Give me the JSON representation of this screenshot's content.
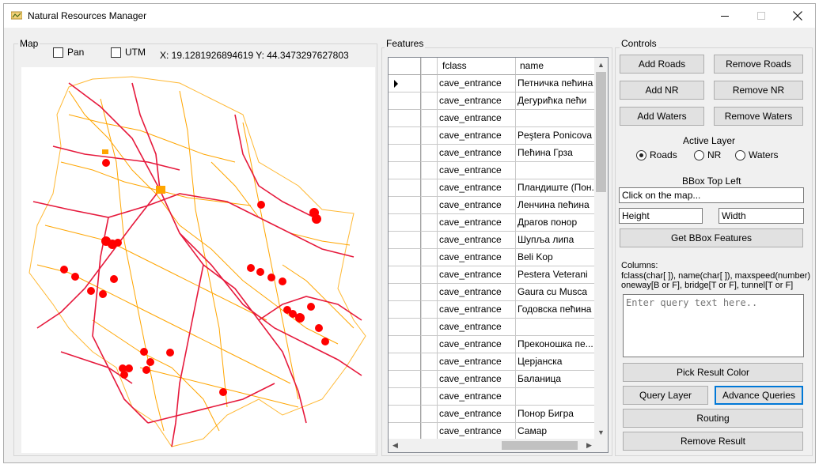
{
  "window": {
    "title": "Natural Resources Manager"
  },
  "map": {
    "group_label": "Map",
    "pan_label": "Pan",
    "utm_label": "UTM",
    "coords_text": "X: 19.1281926894619  Y: 44.3473297627803",
    "colors": {
      "roads": "#e6193c",
      "waters": "#ffa500",
      "points": "#ff0000"
    }
  },
  "features": {
    "group_label": "Features",
    "columns": [
      "",
      "",
      "fclass",
      "name"
    ],
    "rows": [
      {
        "fclass": "cave_entrance",
        "name": "Петничка пећина"
      },
      {
        "fclass": "cave_entrance",
        "name": "Дегурићка пећи"
      },
      {
        "fclass": "cave_entrance",
        "name": ""
      },
      {
        "fclass": "cave_entrance",
        "name": "Peştera Ponicova"
      },
      {
        "fclass": "cave_entrance",
        "name": "Пећина Грза"
      },
      {
        "fclass": "cave_entrance",
        "name": ""
      },
      {
        "fclass": "cave_entrance",
        "name": "Пландиште (Пон..."
      },
      {
        "fclass": "cave_entrance",
        "name": "Ленчина пећина"
      },
      {
        "fclass": "cave_entrance",
        "name": "Драгов понор"
      },
      {
        "fclass": "cave_entrance",
        "name": "Шупља липа"
      },
      {
        "fclass": "cave_entrance",
        "name": "Beli Kop"
      },
      {
        "fclass": "cave_entrance",
        "name": "Pestera Veterani"
      },
      {
        "fclass": "cave_entrance",
        "name": "Gaura cu Musca"
      },
      {
        "fclass": "cave_entrance",
        "name": "Годовска пећина"
      },
      {
        "fclass": "cave_entrance",
        "name": ""
      },
      {
        "fclass": "cave_entrance",
        "name": "Преконошка пе..."
      },
      {
        "fclass": "cave_entrance",
        "name": "Церјанска"
      },
      {
        "fclass": "cave_entrance",
        "name": "Баланица"
      },
      {
        "fclass": "cave_entrance",
        "name": ""
      },
      {
        "fclass": "cave_entrance",
        "name": "Понор Бигра"
      },
      {
        "fclass": "cave_entrance",
        "name": "Самар"
      }
    ]
  },
  "controls": {
    "group_label": "Controls",
    "add_roads": "Add Roads",
    "remove_roads": "Remove Roads",
    "add_nr": "Add NR",
    "remove_nr": "Remove NR",
    "add_waters": "Add Waters",
    "remove_waters": "Remove Waters",
    "active_layer_label": "Active Layer",
    "layers": [
      "Roads",
      "NR",
      "Waters"
    ],
    "active_layer": "Roads",
    "bbox_label": "BBox Top Left",
    "bbox_value": "Click on the map...",
    "height_value": "Height",
    "width_value": "Width",
    "get_bbox": "Get BBox Features",
    "columns_text_1": "Columns:",
    "columns_text_2": "fclass(char[ ]), name(char[ ]), maxspeed(number)",
    "columns_text_3": "oneway[B or F], bridge[T or F], tunnel[T or F]",
    "query_placeholder": "Enter query text here..",
    "pick_color": "Pick Result Color",
    "query_layer": "Query Layer",
    "advanced_queries": "Advance Queries",
    "routing": "Routing",
    "remove_result": "Remove Result"
  }
}
